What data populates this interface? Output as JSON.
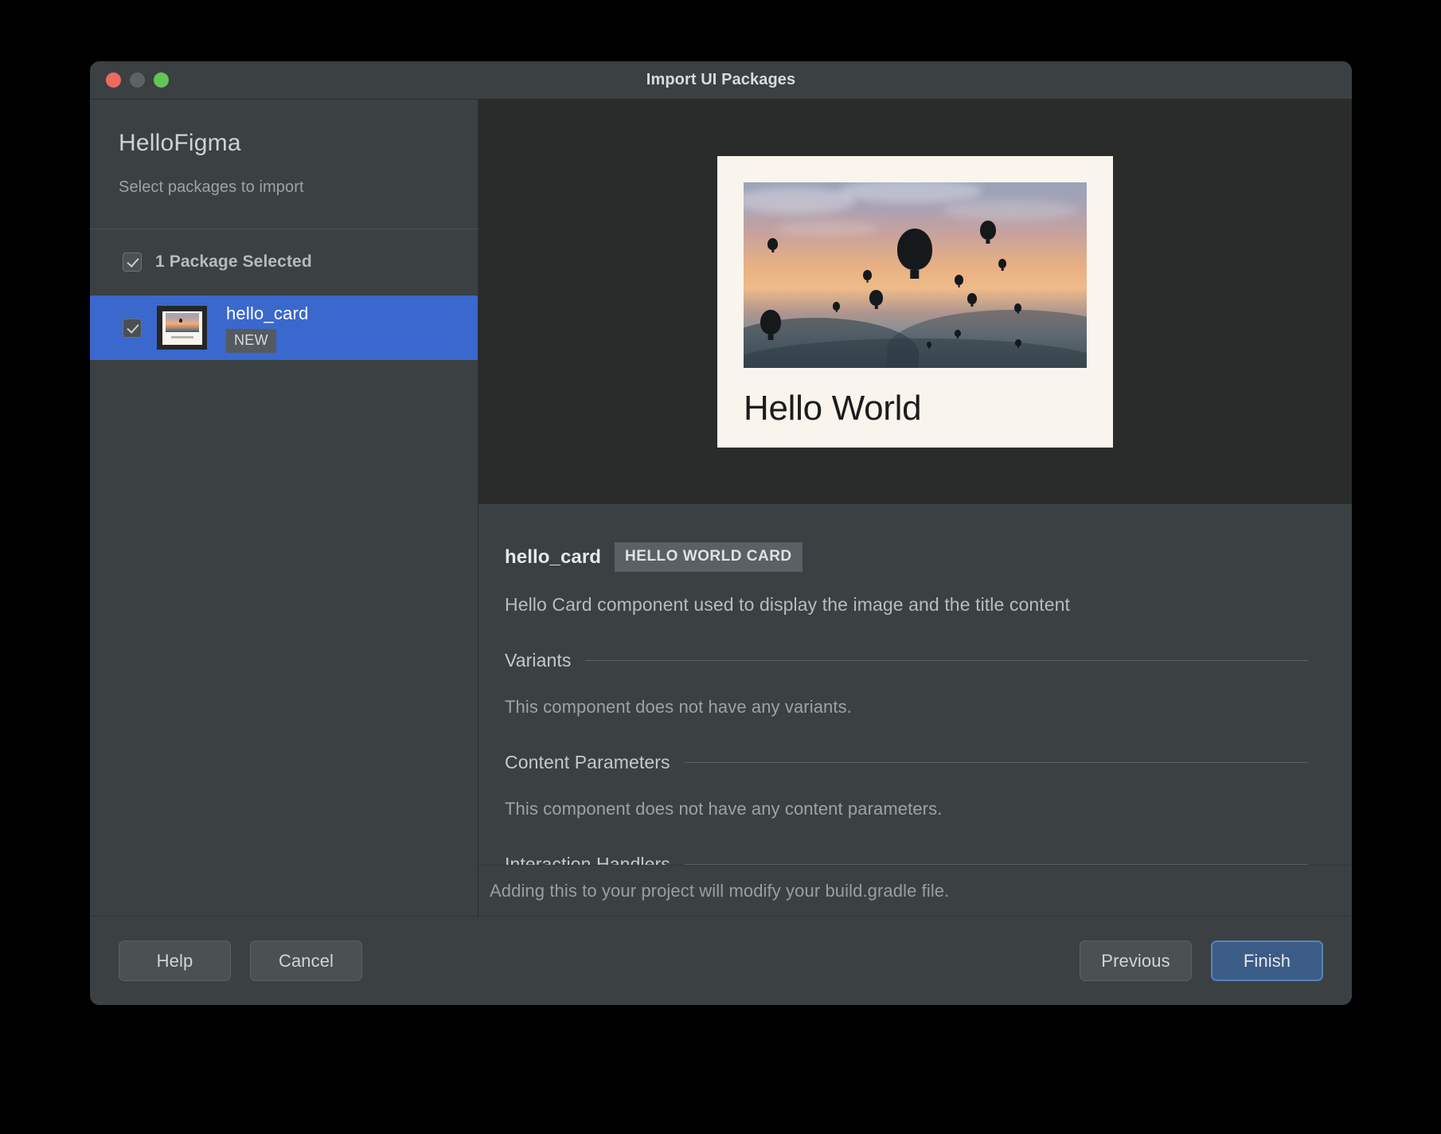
{
  "window": {
    "title": "Import UI Packages",
    "traffic_lights": [
      "close-button",
      "minimize-button",
      "maximize-button"
    ]
  },
  "sidebar": {
    "project_name": "HelloFigma",
    "subtitle": "Select packages to import",
    "select_all": {
      "label": "1 Package Selected",
      "checked": true
    },
    "packages": [
      {
        "name": "hello_card",
        "badge": "NEW",
        "checked": true,
        "selected": true
      }
    ]
  },
  "preview": {
    "card_title": "Hello World",
    "image_alt": "hot-air-balloons-at-sunset"
  },
  "detail": {
    "name": "hello_card",
    "badge": "HELLO WORLD CARD",
    "description": "Hello Card component used to display the image and the title content",
    "sections": [
      {
        "heading": "Variants",
        "body": "This component does not have any variants."
      },
      {
        "heading": "Content Parameters",
        "body": "This component does not have any content parameters."
      },
      {
        "heading": "Interaction Handlers",
        "body": ""
      }
    ]
  },
  "note": "Adding this to your project will modify your build.gradle file.",
  "footer": {
    "help_label": "Help",
    "cancel_label": "Cancel",
    "previous_label": "Previous",
    "finish_label": "Finish"
  },
  "colors": {
    "selection_blue": "#3a68cd",
    "default_button_blue": "#3b5c87",
    "window_bg": "#3b4043",
    "preview_bg": "#2a2b2b",
    "card_bg": "#faf5ec"
  }
}
